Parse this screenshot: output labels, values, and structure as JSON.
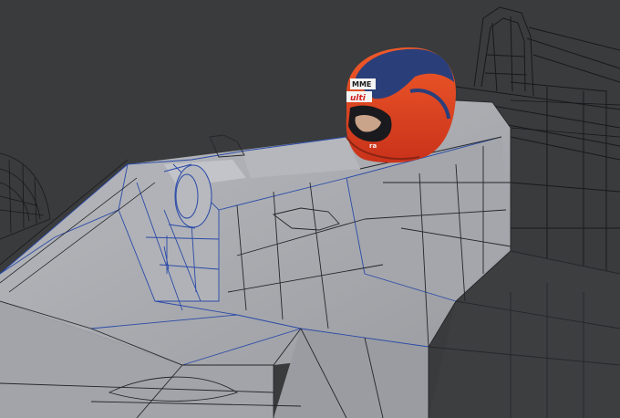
{
  "viewport": {
    "background": "#3a3b3c",
    "body_fill": "#a6a8ad",
    "body_fill_light": "#b8babf",
    "body_fill_dark": "#8e9095",
    "wire_dark": "#1c1d20",
    "wire_blue": "#2b4aa8",
    "helmet_red": "#e6401e",
    "helmet_blue": "#2a3f7a",
    "icons": [
      "helmet-icon"
    ]
  },
  "helmet": {
    "sponsor_top": "MME",
    "sponsor_side": "ulti",
    "sponsor_chin": "ra"
  }
}
